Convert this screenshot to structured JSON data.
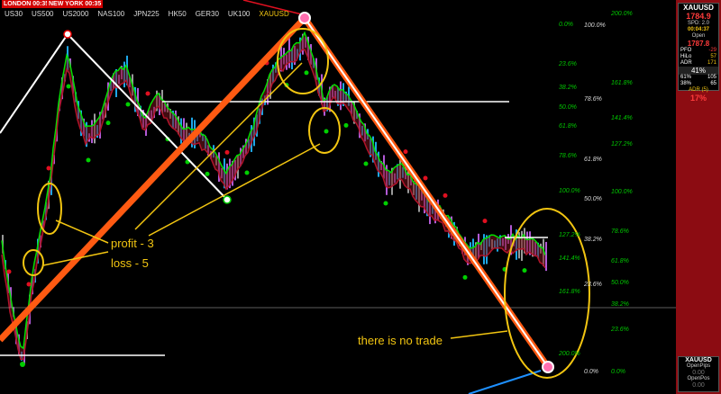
{
  "sessions": {
    "london": "LONDON  00:35",
    "newyork": "NEW YORK 00:35"
  },
  "symbols": [
    "US30",
    "US500",
    "US2000",
    "NAS100",
    "JPN225",
    "HK50",
    "GER30",
    "UK100",
    "XAUUSD"
  ],
  "active_symbol": "XAUUSD",
  "fib_green": [
    "0.0%",
    "23.6%",
    "38.2%",
    "50.0%",
    "61.8%",
    "78.6%",
    "100.0%",
    "127.2%",
    "141.4%",
    "161.8%",
    "200.0%"
  ],
  "fib_white_a": [
    "100.0%",
    "78.6%",
    "61.8%",
    "50.0%",
    "38.2%",
    "23.6%",
    "0.0%"
  ],
  "fib_green_b": [
    "200.0%",
    "161.8%",
    "141.4%",
    "127.2%",
    "100.0%",
    "78.6%",
    "61.8%",
    "50.0%",
    "38.2%",
    "23.6%",
    "0.0%"
  ],
  "annotations": {
    "profit": "profit - 3",
    "loss": "loss - 5",
    "notrade": "there is no trade"
  },
  "panel": {
    "symbol": "XAUUSD",
    "price": "1784.9",
    "spd": "SPD: 2.0",
    "timer": "00:04:37",
    "open_label": "Open",
    "open_value": "1787.8",
    "rows": [
      {
        "k": "PFO",
        "v": "-29"
      },
      {
        "k": "HiLo",
        "v": "57"
      },
      {
        "k": "ADR",
        "v": "171"
      }
    ],
    "pct": "41%",
    "grid": [
      {
        "a": "61%",
        "b": "105"
      },
      {
        "a": "38%",
        "b": "65"
      }
    ],
    "adr_label": "ADR (5)",
    "adr_pct": "17%",
    "bottom_symbol": "XAUUSD",
    "open_pips_label": "OpenPips",
    "open_pips": "0.00",
    "open_pos_label": "OpenPos",
    "open_pos": "0.00"
  },
  "colors": {
    "bull": "#1ea7e8",
    "bear": "#b25ad6",
    "neutral": "#9a9a9a",
    "maroon": "#b0142a",
    "gold": "#f2c511",
    "green": "#00e000",
    "orange": "#ff5a12"
  }
}
